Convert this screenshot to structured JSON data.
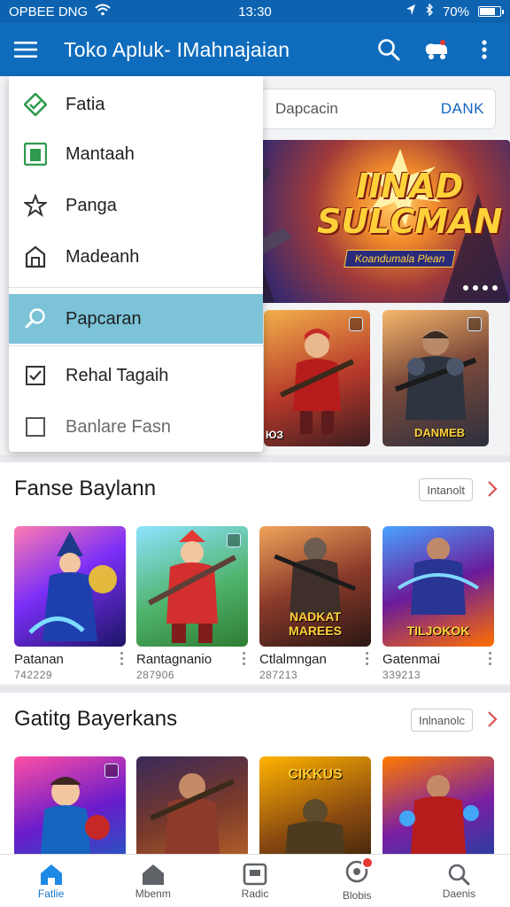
{
  "status_bar": {
    "carrier": "OPBEE DNG",
    "time": "13:30",
    "battery": "70%",
    "battery_level": 0.7
  },
  "app_bar": {
    "title": "Toko Apluk- IMahnajaian",
    "icons": [
      "menu-icon",
      "search-icon",
      "cart-icon",
      "more-vert-icon"
    ]
  },
  "search": {
    "placeholder": "Dapcacin",
    "button_label": "DANK"
  },
  "banner": {
    "title": "IINAD\nSULCMAN",
    "subtitle": "Koandumala Plean"
  },
  "hero_tiles": [
    {
      "caption": "ЮЗ"
    },
    {
      "caption": "DANMEB"
    }
  ],
  "drawer": {
    "items": [
      {
        "label": "Fatia",
        "icon": "diamond-tag-icon",
        "active": false
      },
      {
        "label": "Mantaah",
        "icon": "app-box-icon",
        "active": false
      },
      {
        "label": "Panga",
        "icon": "star-icon",
        "active": false
      },
      {
        "label": "Madeanh",
        "icon": "store-icon",
        "active": false
      },
      {
        "label": "Papcaran",
        "icon": "search-icon",
        "active": true
      },
      {
        "label": "Rehal Tagaih",
        "icon": "checkbox-checked-icon",
        "active": false
      },
      {
        "label": "Banlare Fasn",
        "icon": "checkbox-empty-icon",
        "active": false
      }
    ]
  },
  "sections": [
    {
      "title": "Fanse Baylann",
      "more_label": "Intanolt",
      "cards": [
        {
          "name": "Patanan",
          "count": "742229",
          "caption": ""
        },
        {
          "name": "Rantagnanio",
          "count": "287906",
          "caption": ""
        },
        {
          "name": "Ctlalmngan",
          "count": "287213",
          "caption": "NADKAT MAREES"
        },
        {
          "name": "Gatenmai",
          "count": "339213",
          "caption": "TILJOKOK"
        }
      ]
    },
    {
      "title": "Gatitg Bayerkans",
      "more_label": "Inlnanolc",
      "cards": [
        {
          "name": "",
          "count": "",
          "caption": ""
        },
        {
          "name": "",
          "count": "",
          "caption": ""
        },
        {
          "name": "",
          "count": "",
          "caption": "CIKKUS"
        },
        {
          "name": "",
          "count": "",
          "caption": ""
        }
      ]
    }
  ],
  "bottom_nav": {
    "items": [
      {
        "label": "Fatlie",
        "icon": "home-icon",
        "active": true
      },
      {
        "label": "Mbenm",
        "icon": "home-outline-icon",
        "active": false
      },
      {
        "label": "Radic",
        "icon": "tablet-icon",
        "active": false
      },
      {
        "label": "Blobis",
        "icon": "profile-icon",
        "active": false
      },
      {
        "label": "Daenis",
        "icon": "search-icon",
        "active": false
      }
    ]
  },
  "colors": {
    "app_bar": "#0f6cbd",
    "status_bar": "#0d63b0",
    "drawer_active": "#7cc3d8",
    "accent": "#1576c5",
    "chevron": "#d9534f"
  }
}
